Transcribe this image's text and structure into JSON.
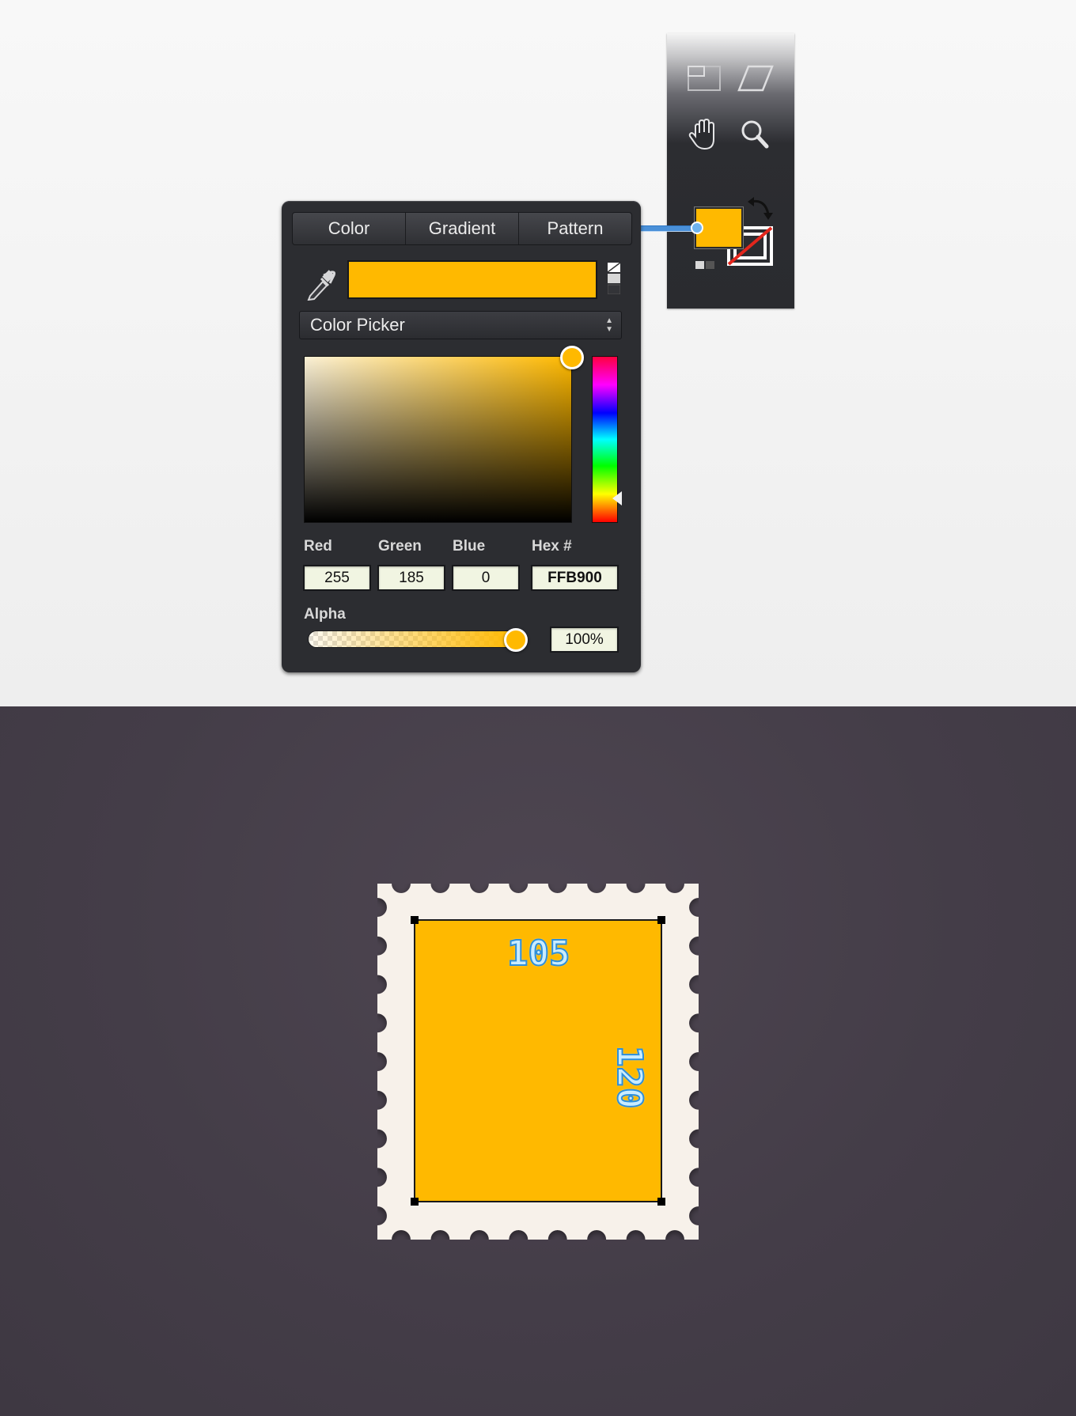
{
  "tabs": [
    "Color",
    "Gradient",
    "Pattern"
  ],
  "picker_mode": "Color Picker",
  "current_color": "#FFB900",
  "labels": {
    "red": "Red",
    "green": "Green",
    "blue": "Blue",
    "hex": "Hex #",
    "alpha": "Alpha"
  },
  "values": {
    "red": "255",
    "green": "185",
    "blue": "0",
    "hex": "FFB900",
    "alpha": "100%"
  },
  "toolbar": {
    "icons": [
      "transform-icon",
      "skew-icon",
      "hand-icon",
      "zoom-icon",
      "swap-icon",
      "default-colors-icon"
    ],
    "fill_color": "#FFB900",
    "stroke_color": "none"
  },
  "canvas": {
    "stamp_fill": "#FFB900",
    "stamp_border": "#F7F1EA",
    "width_label": "105",
    "height_label": "120"
  }
}
